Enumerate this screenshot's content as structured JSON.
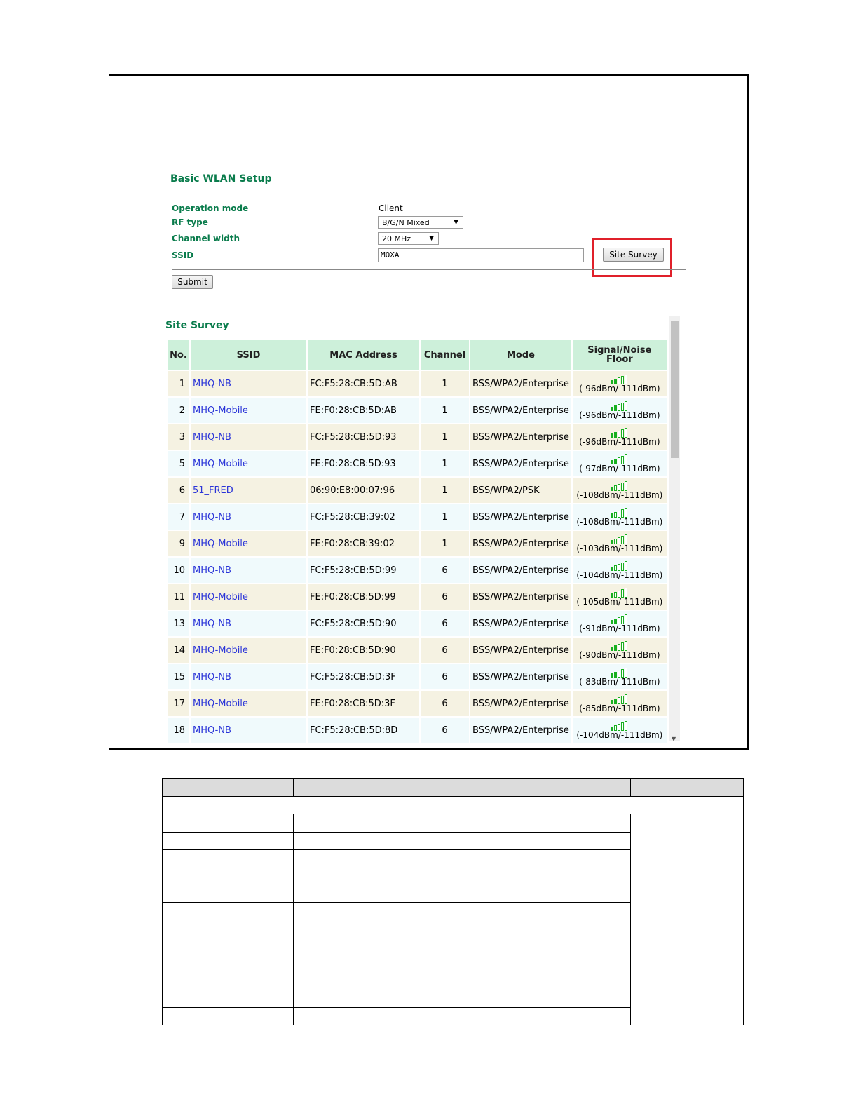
{
  "basic_wlan": {
    "title": "Basic WLAN Setup",
    "operation_mode_label": "Operation mode",
    "operation_mode_value": "Client",
    "rf_type_label": "RF type",
    "rf_type_value": "B/G/N Mixed",
    "channel_width_label": "Channel width",
    "channel_width_value": "20 MHz",
    "ssid_label": "SSID",
    "ssid_value": "MOXA",
    "site_survey_button": "Site Survey",
    "submit_button": "Submit"
  },
  "site_survey": {
    "title": "Site Survey",
    "columns": [
      "No.",
      "SSID",
      "MAC Address",
      "Channel",
      "Mode",
      "Signal/Noise Floor"
    ],
    "rows": [
      {
        "no": "1",
        "ssid": "MHQ-NB",
        "mac": "FC:F5:28:CB:5D:AB",
        "channel": "1",
        "mode": "BSS/WPA2/Enterprise",
        "signal": "(-96dBm/-111dBm)",
        "bars": 2
      },
      {
        "no": "2",
        "ssid": "MHQ-Mobile",
        "mac": "FE:F0:28:CB:5D:AB",
        "channel": "1",
        "mode": "BSS/WPA2/Enterprise",
        "signal": "(-96dBm/-111dBm)",
        "bars": 2
      },
      {
        "no": "3",
        "ssid": "MHQ-NB",
        "mac": "FC:F5:28:CB:5D:93",
        "channel": "1",
        "mode": "BSS/WPA2/Enterprise",
        "signal": "(-96dBm/-111dBm)",
        "bars": 2
      },
      {
        "no": "5",
        "ssid": "MHQ-Mobile",
        "mac": "FE:F0:28:CB:5D:93",
        "channel": "1",
        "mode": "BSS/WPA2/Enterprise",
        "signal": "(-97dBm/-111dBm)",
        "bars": 2
      },
      {
        "no": "6",
        "ssid": "51_FRED",
        "mac": "06:90:E8:00:07:96",
        "channel": "1",
        "mode": "BSS/WPA2/PSK",
        "signal": "(-108dBm/-111dBm)",
        "bars": 1
      },
      {
        "no": "7",
        "ssid": "MHQ-NB",
        "mac": "FC:F5:28:CB:39:02",
        "channel": "1",
        "mode": "BSS/WPA2/Enterprise",
        "signal": "(-108dBm/-111dBm)",
        "bars": 1
      },
      {
        "no": "9",
        "ssid": "MHQ-Mobile",
        "mac": "FE:F0:28:CB:39:02",
        "channel": "1",
        "mode": "BSS/WPA2/Enterprise",
        "signal": "(-103dBm/-111dBm)",
        "bars": 1
      },
      {
        "no": "10",
        "ssid": "MHQ-NB",
        "mac": "FC:F5:28:CB:5D:99",
        "channel": "6",
        "mode": "BSS/WPA2/Enterprise",
        "signal": "(-104dBm/-111dBm)",
        "bars": 1
      },
      {
        "no": "11",
        "ssid": "MHQ-Mobile",
        "mac": "FE:F0:28:CB:5D:99",
        "channel": "6",
        "mode": "BSS/WPA2/Enterprise",
        "signal": "(-105dBm/-111dBm)",
        "bars": 1
      },
      {
        "no": "13",
        "ssid": "MHQ-NB",
        "mac": "FC:F5:28:CB:5D:90",
        "channel": "6",
        "mode": "BSS/WPA2/Enterprise",
        "signal": "(-91dBm/-111dBm)",
        "bars": 2
      },
      {
        "no": "14",
        "ssid": "MHQ-Mobile",
        "mac": "FE:F0:28:CB:5D:90",
        "channel": "6",
        "mode": "BSS/WPA2/Enterprise",
        "signal": "(-90dBm/-111dBm)",
        "bars": 2
      },
      {
        "no": "15",
        "ssid": "MHQ-NB",
        "mac": "FC:F5:28:CB:5D:3F",
        "channel": "6",
        "mode": "BSS/WPA2/Enterprise",
        "signal": "(-83dBm/-111dBm)",
        "bars": 2
      },
      {
        "no": "17",
        "ssid": "MHQ-Mobile",
        "mac": "FE:F0:28:CB:5D:3F",
        "channel": "6",
        "mode": "BSS/WPA2/Enterprise",
        "signal": "(-85dBm/-111dBm)",
        "bars": 2
      },
      {
        "no": "18",
        "ssid": "MHQ-NB",
        "mac": "FC:F5:28:CB:5D:8D",
        "channel": "6",
        "mode": "BSS/WPA2/Enterprise",
        "signal": "(-104dBm/-111dBm)",
        "bars": 1
      }
    ]
  },
  "colors": {
    "label_green": "#0a7c4c",
    "link_blue": "#2b35d8",
    "header_green": "#cdf0da",
    "highlight_red": "#e0202a",
    "signal_green": "#18b020"
  }
}
